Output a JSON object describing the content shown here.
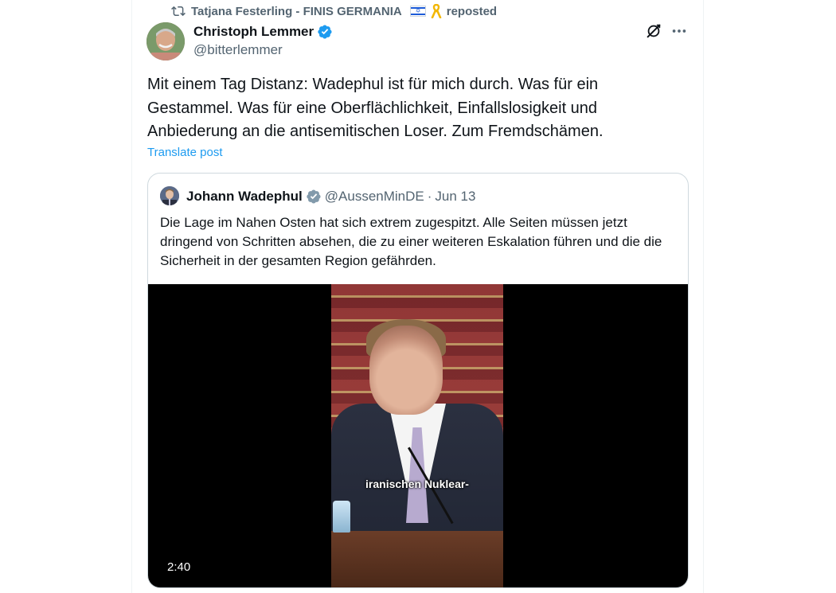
{
  "repost": {
    "user": "Tatjana Festerling - FINIS GERMANIA",
    "action": "reposted",
    "icon": "repost-icon"
  },
  "post": {
    "author_name": "Christoph Lemmer",
    "author_handle": "@bitterlemmer",
    "text": "Mit einem Tag Distanz: Wadephul ist für mich durch. Was für ein Gestammel. Was für eine Oberflächlichkeit, Einfallslosigkeit und Anbiederung an die antisemitischen Loser. Zum Fremdschämen.",
    "translate_label": "Translate post"
  },
  "quote": {
    "author_name": "Johann Wadephul",
    "author_handle": "@AussenMinDE",
    "separator": "·",
    "date": "Jun 13",
    "text": "Die Lage im Nahen Osten hat sich extrem zugespitzt. Alle Seiten müssen jetzt dringend von Schritten absehen, die zu einer weiteren Eskalation führen und die die Sicherheit in der gesamten Region gefährden.",
    "video": {
      "subtitle": "iranischen Nuklear-",
      "duration": "2:40"
    }
  },
  "colors": {
    "accent": "#1d9bf0",
    "text_primary": "#0f1419",
    "text_secondary": "#536471",
    "border": "#cfd9de"
  }
}
